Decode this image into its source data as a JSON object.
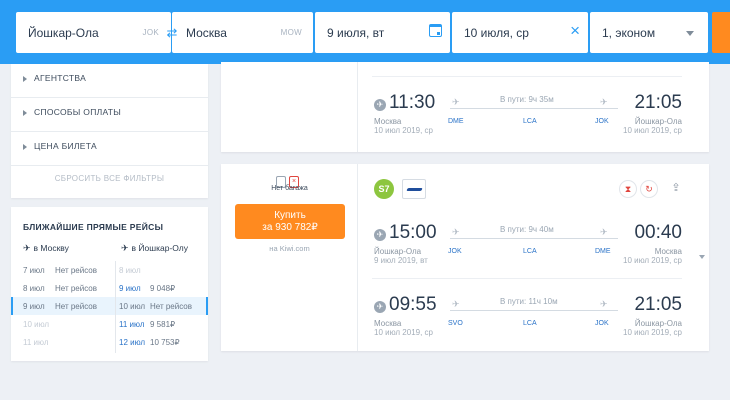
{
  "search": {
    "from_city": "Йошкар-Ола",
    "from_code": "JOK",
    "to_city": "Москва",
    "to_code": "MOW",
    "depart_date": "9 июля, вт",
    "return_date": "10 июля, ср",
    "passengers": "1, эконом",
    "colors": {
      "bar": "#2a9df4",
      "search_button": "#ff8a1f"
    }
  },
  "icons": {
    "swap": "swap-icon",
    "calendar": "calendar-icon",
    "clear": "close-icon",
    "dropdown": "chevron-down-icon",
    "share": "share-icon",
    "plane": "plane-icon"
  },
  "filters": {
    "items": [
      {
        "label": "АГЕНТСТВА"
      },
      {
        "label": "СПОСОБЫ ОПЛАТЫ"
      },
      {
        "label": "ЦЕНА БИЛЕТА"
      }
    ],
    "reset_label": "СБРОСИТЬ ВСЕ ФИЛЬТРЫ"
  },
  "direct_flights": {
    "title": "БЛИЖАЙШИЕ ПРЯМЫЕ РЕЙСЫ",
    "to_moscow": "в Москву",
    "to_yoshkar": "в Йошкар-Олу",
    "outbound": [
      {
        "date": "7 июл",
        "price": "Нет рейсов"
      },
      {
        "date": "8 июл",
        "price": "Нет рейсов"
      },
      {
        "date": "9 июл",
        "price": "Нет рейсов"
      },
      {
        "date": "10 июл",
        "price": ""
      },
      {
        "date": "11 июл",
        "price": ""
      }
    ],
    "inbound": [
      {
        "date": "8 июл",
        "price": ""
      },
      {
        "date": "9 июл",
        "price": "9 048₽"
      },
      {
        "date": "10 июл",
        "price": "Нет рейсов"
      },
      {
        "date": "11 июл",
        "price": "9 581₽"
      },
      {
        "date": "12 июл",
        "price": "10 753₽"
      }
    ]
  },
  "tickets": [
    {
      "return": {
        "dep_time": "11:30",
        "dep_city": "Москва",
        "dep_date": "10 июл 2019, ср",
        "duration": "В пути: 9ч 35м",
        "airports": [
          "DME",
          "LCA",
          "JOK"
        ],
        "arr_time": "21:05",
        "arr_city": "Йошкар-Ола",
        "arr_date": "10 июл 2019, ср"
      }
    },
    {
      "baggage": "Нет багажа",
      "buy_label": "Купить",
      "price": "за 930 782₽",
      "agent": "на Kiwi.com",
      "airline_1": "S7",
      "outbound": {
        "dep_time": "15:00",
        "dep_city": "Йошкар-Ола",
        "dep_date": "9 июл 2019, вт",
        "duration": "В пути: 9ч 40м",
        "airports": [
          "JOK",
          "LCA",
          "DME"
        ],
        "arr_time": "00:40",
        "arr_city": "Москва",
        "arr_date": "10 июл 2019, ср"
      },
      "return": {
        "dep_time": "09:55",
        "dep_city": "Москва",
        "dep_date": "10 июл 2019, ср",
        "duration": "В пути: 11ч 10м",
        "airports": [
          "SVO",
          "LCA",
          "JOK"
        ],
        "arr_time": "21:05",
        "arr_city": "Йошкар-Ола",
        "arr_date": "10 июл 2019, ср"
      }
    }
  ]
}
